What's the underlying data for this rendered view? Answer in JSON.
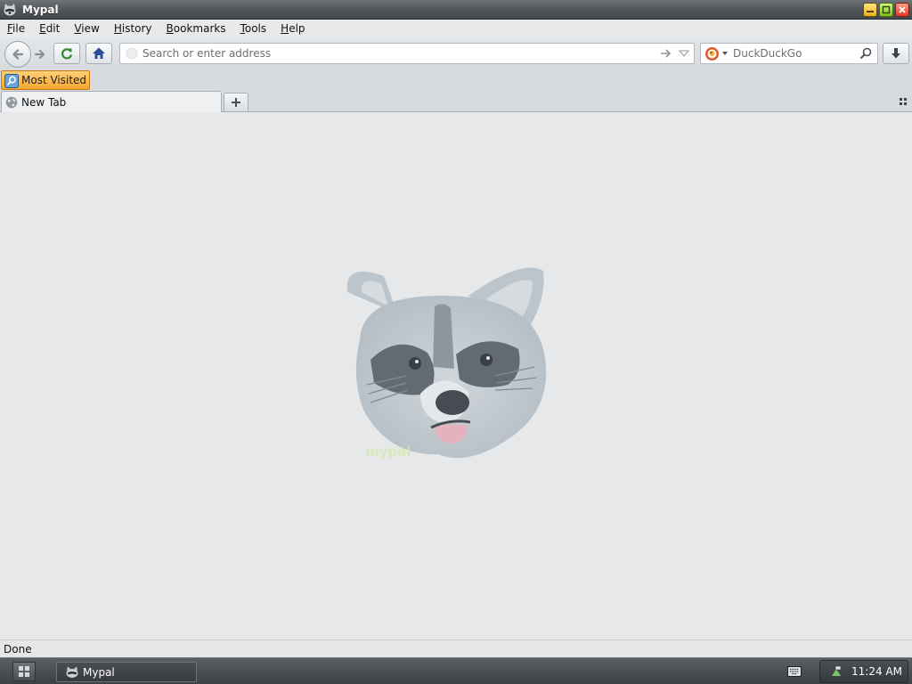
{
  "window": {
    "title": "Mypal"
  },
  "menubar": {
    "items": [
      {
        "accel": "F",
        "rest": "ile"
      },
      {
        "accel": "E",
        "rest": "dit"
      },
      {
        "accel": "V",
        "rest": "iew"
      },
      {
        "accel": "H",
        "rest": "istory"
      },
      {
        "accel": "B",
        "rest": "ookmarks"
      },
      {
        "accel": "T",
        "rest": "ools"
      },
      {
        "accel": "H",
        "rest": "elp"
      }
    ]
  },
  "navbar": {
    "url_placeholder": "Search or enter address",
    "search_placeholder": "DuckDuckGo"
  },
  "bookmarks": {
    "most_visited": "Most Visited"
  },
  "tabs": [
    {
      "label": "New Tab"
    }
  ],
  "content": {
    "logo_subtext": "mypal"
  },
  "status": {
    "text": "Done"
  },
  "taskbar": {
    "window_label": "Mypal",
    "clock": "11:24 AM"
  },
  "colors": {
    "accent_orange": "#f7a830",
    "home_blue": "#2a4f99",
    "reload_green": "#2f8a2f"
  }
}
